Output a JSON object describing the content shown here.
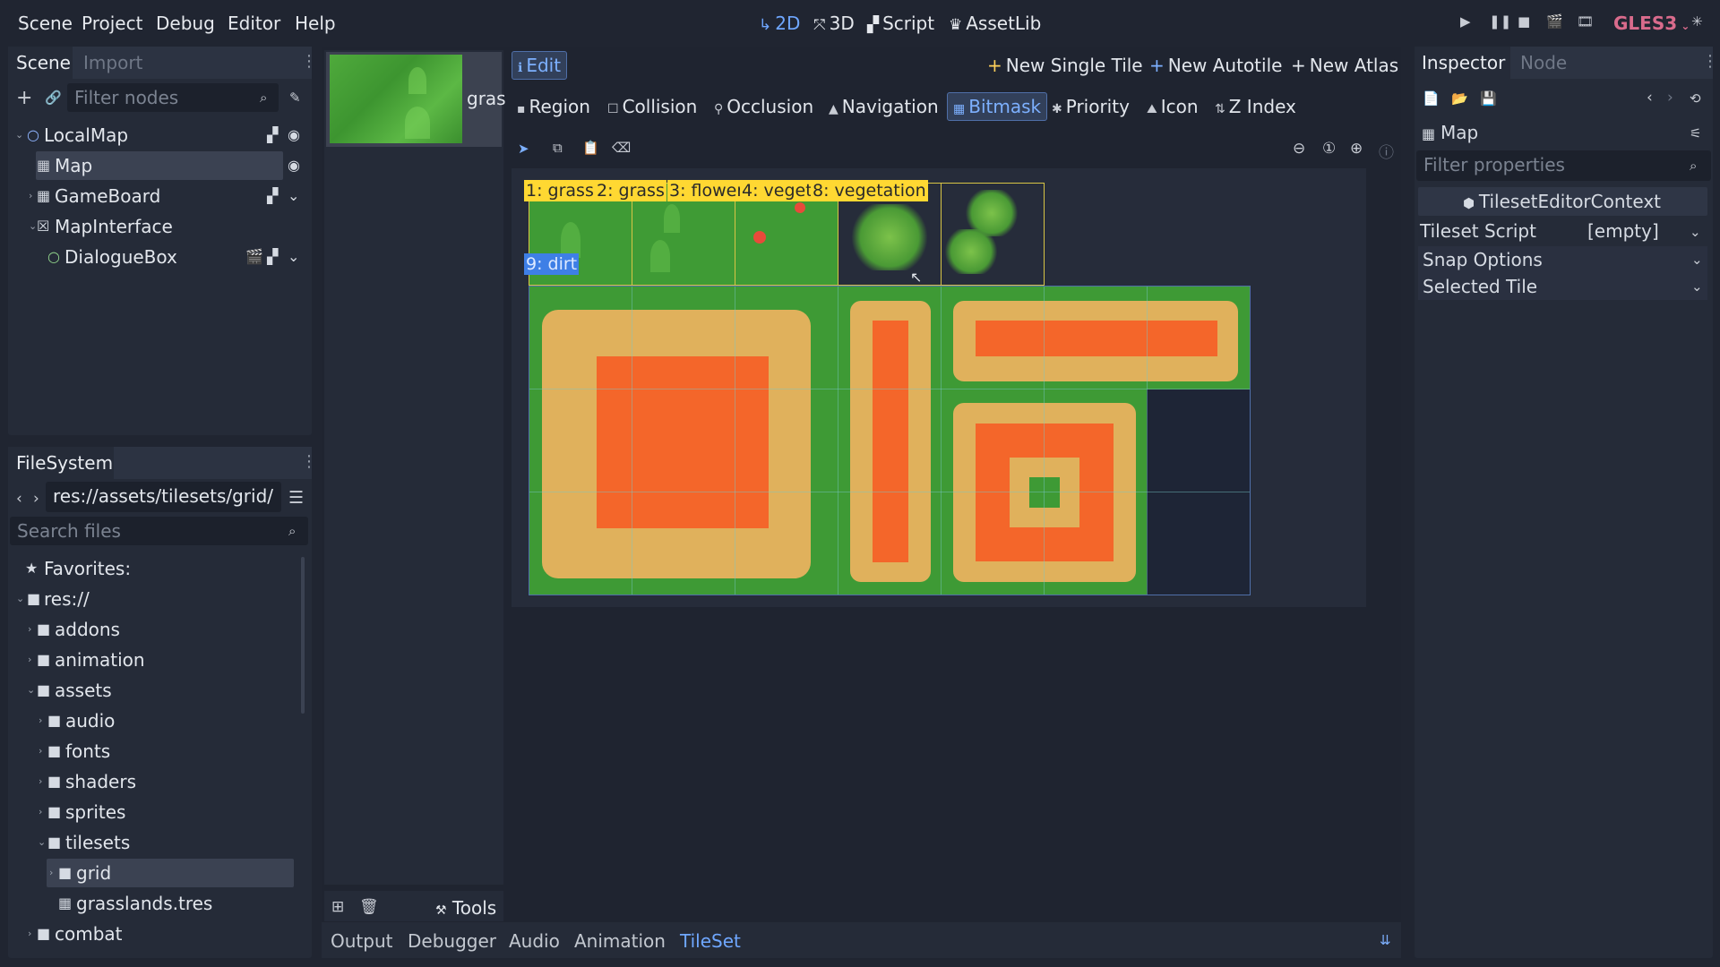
{
  "menu": [
    "Scene",
    "Project",
    "Debug",
    "Editor",
    "Help"
  ],
  "workspaces": [
    {
      "label": "2D",
      "icon": "2d-icon",
      "active": true
    },
    {
      "label": "3D",
      "icon": "3d-icon",
      "active": false
    },
    {
      "label": "Script",
      "icon": "script-icon",
      "active": false
    },
    {
      "label": "AssetLib",
      "icon": "assetlib-icon",
      "active": false
    }
  ],
  "renderer": "GLES3",
  "scene_dock": {
    "tabs": [
      "Scene",
      "Import"
    ],
    "filter_placeholder": "Filter nodes",
    "nodes": [
      {
        "label": "LocalMap"
      },
      {
        "label": "Map"
      },
      {
        "label": "GameBoard"
      },
      {
        "label": "MapInterface"
      },
      {
        "label": "DialogueBox"
      }
    ]
  },
  "filesystem": {
    "tab": "FileSystem",
    "path": "res://assets/tilesets/grid/",
    "search_placeholder": "Search files",
    "items": [
      "Favorites:",
      "res://",
      "addons",
      "animation",
      "assets",
      "audio",
      "fonts",
      "shaders",
      "sprites",
      "tilesets",
      "grid",
      "grasslands.tres",
      "combat"
    ]
  },
  "texture_list": {
    "item_label": "gras",
    "tools_label": "Tools"
  },
  "tileset_editor": {
    "edit_label": "Edit",
    "new_single_tile": "New Single Tile",
    "new_autotile": "New Autotile",
    "new_atlas": "New Atlas",
    "modes": [
      "Region",
      "Collision",
      "Occlusion",
      "Navigation",
      "Bitmask",
      "Priority",
      "Icon",
      "Z Index"
    ],
    "active_mode": "Bitmask",
    "tile_labels": [
      "1: grass",
      "2: grass",
      "3: flower",
      "4: veget",
      "8: vegetation",
      "9: dirt"
    ],
    "colors": {
      "grass": "#3e9a35",
      "dirt": "#e0b15c",
      "mask": "#f4662a",
      "empty": "#1e2536",
      "label": "#ffd832"
    }
  },
  "bottom_tabs": [
    "Output",
    "Debugger",
    "Audio",
    "Animation",
    "TileSet"
  ],
  "active_bottom_tab": "TileSet",
  "inspector": {
    "tabs": [
      "Inspector",
      "Node"
    ],
    "object": "Map",
    "filter_placeholder": "Filter properties",
    "context": "TilesetEditorContext",
    "tileset_script_label": "Tileset Script",
    "tileset_script_value": "[empty]",
    "sections": [
      "Snap Options",
      "Selected Tile"
    ]
  }
}
